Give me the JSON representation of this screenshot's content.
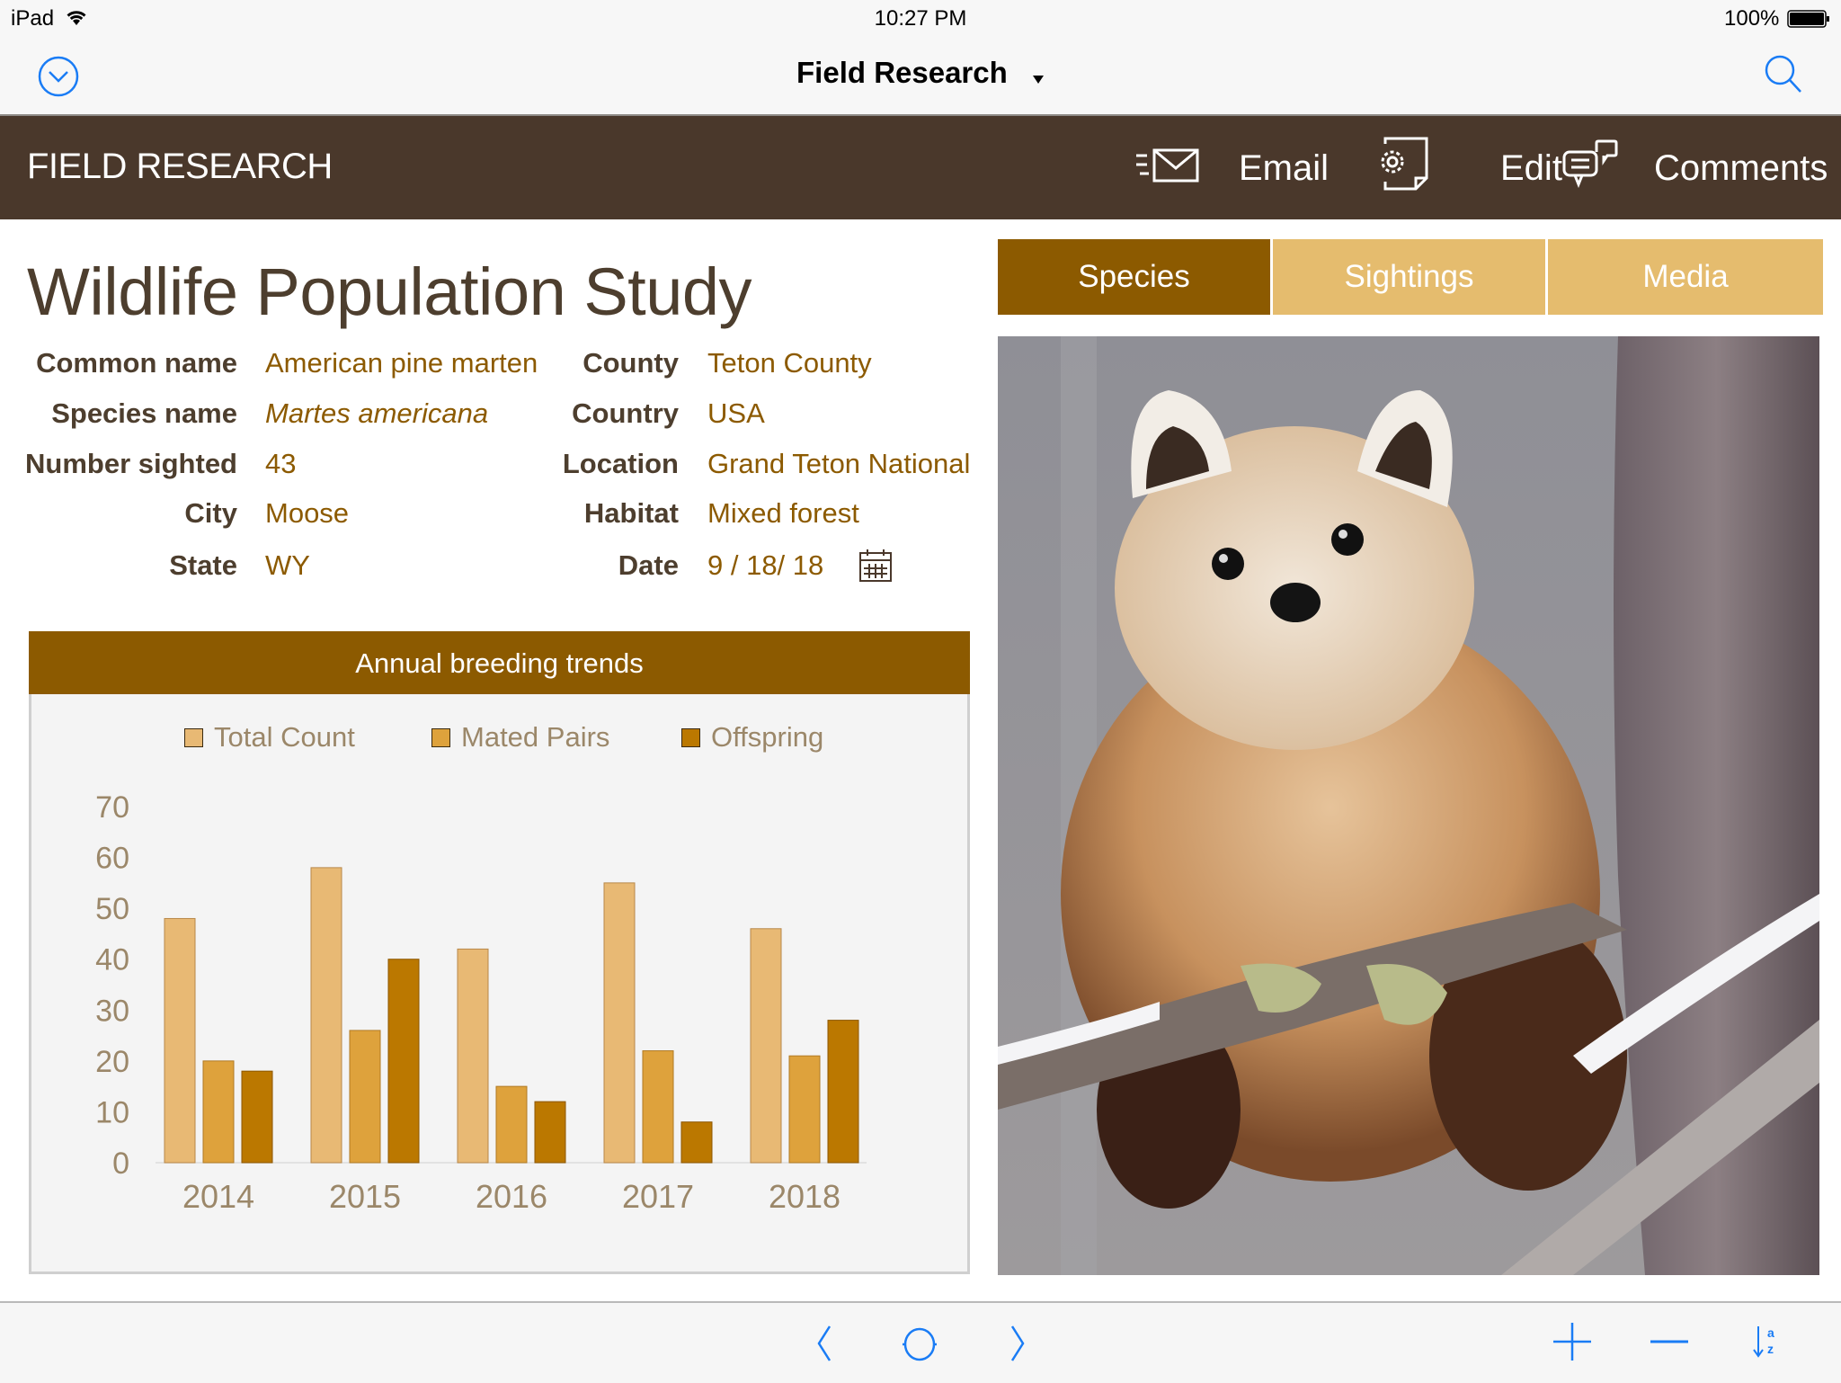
{
  "status_bar": {
    "device": "iPad",
    "time": "10:27 PM",
    "battery": "100%"
  },
  "nav_bar": {
    "title": "Field Research",
    "left_icon": "chevron-down-circle-icon",
    "right_icon": "search-icon"
  },
  "header": {
    "brand": "FIELD RESEARCH",
    "actions": [
      {
        "label": "Email",
        "icon": "email-icon"
      },
      {
        "label": "Edit",
        "icon": "edit-document-icon"
      },
      {
        "label": "Comments",
        "icon": "comments-icon"
      }
    ]
  },
  "record": {
    "title": "Wildlife Population Study",
    "fields_left": [
      {
        "label": "Common name",
        "value": "American pine marten"
      },
      {
        "label": "Species name",
        "value": "Martes americana"
      },
      {
        "label": "Number sighted",
        "value": "43"
      },
      {
        "label": "City",
        "value": "Moose"
      },
      {
        "label": "State",
        "value": "WY"
      }
    ],
    "fields_right": [
      {
        "label": "County",
        "value": "Teton County"
      },
      {
        "label": "Country",
        "value": "USA"
      },
      {
        "label": "Location",
        "value": "Grand Teton National"
      },
      {
        "label": "Habitat",
        "value": "Mixed forest"
      },
      {
        "label": "Date",
        "value": "9 / 18/ 18"
      }
    ]
  },
  "tabs": [
    {
      "label": "Species",
      "active": true
    },
    {
      "label": "Sightings",
      "active": false
    },
    {
      "label": "Media",
      "active": false
    }
  ],
  "photo": {
    "subject": "American pine marten on snowy branch"
  },
  "colors": {
    "header_bg": "#4a382b",
    "accent": "#8c5a00",
    "tab_inactive": "#e5bc6e",
    "ios_blue": "#1a7cf5",
    "total_count": "#e8b974",
    "mated_pairs": "#dea23c",
    "offspring": "#bb7800"
  },
  "chart_data": {
    "type": "bar",
    "title": "Annual breeding trends",
    "categories": [
      "2014",
      "2015",
      "2016",
      "2017",
      "2018"
    ],
    "series": [
      {
        "name": "Total Count",
        "values": [
          48,
          58,
          42,
          55,
          46
        ]
      },
      {
        "name": "Mated Pairs",
        "values": [
          20,
          26,
          15,
          22,
          21
        ]
      },
      {
        "name": "Offspring",
        "values": [
          18,
          40,
          12,
          8,
          28
        ]
      }
    ],
    "xlabel": "",
    "ylabel": "",
    "ylim": [
      0,
      70
    ],
    "yticks": [
      0,
      10,
      20,
      30,
      40,
      50,
      60,
      70
    ],
    "grid": false,
    "legend": "top-center"
  },
  "bottom_bar": {
    "items": [
      {
        "name": "previous-record-button",
        "icon": "chevron-left-icon"
      },
      {
        "name": "record-indicator-button",
        "icon": "circle-icon"
      },
      {
        "name": "next-record-button",
        "icon": "chevron-right-icon"
      },
      {
        "name": "add-record-button",
        "icon": "plus-icon"
      },
      {
        "name": "delete-record-button",
        "icon": "minus-icon"
      },
      {
        "name": "sort-button",
        "icon": "sort-az-icon"
      }
    ]
  }
}
